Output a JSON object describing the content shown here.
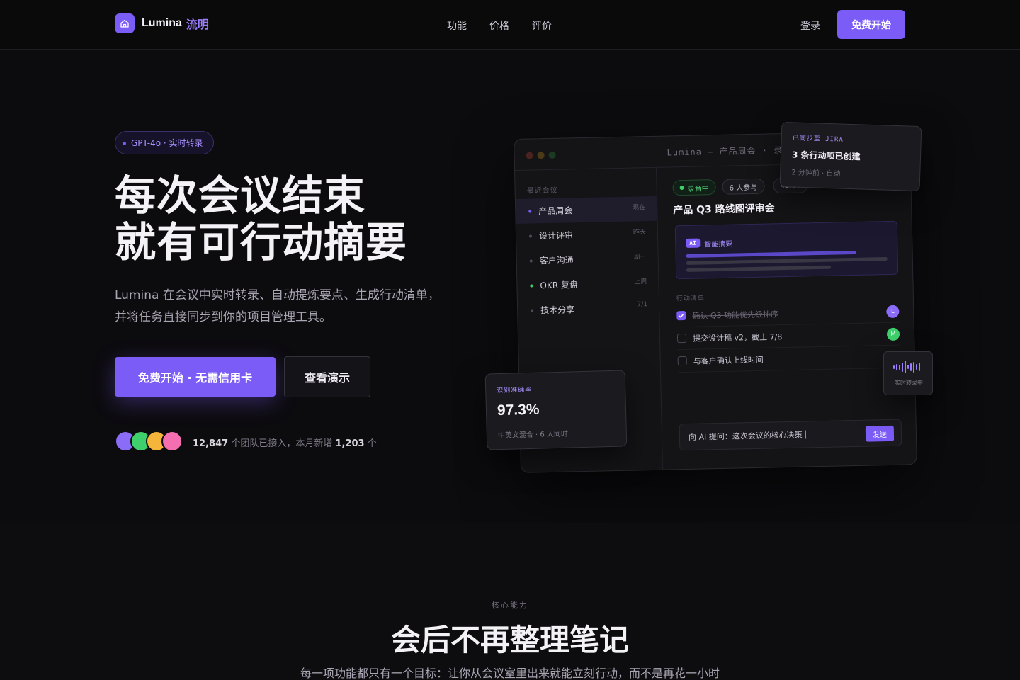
{
  "nav": {
    "brand": "Lumina",
    "brand_cn": "流明",
    "links": [
      "功能",
      "价格",
      "评价"
    ],
    "login": "登录",
    "cta": "免费开始"
  },
  "hero": {
    "badge": "GPT-4o · 实时转录",
    "title_line1": "每次会议结束",
    "title_line2": "就有可行动摘要",
    "subtitle_line1": "Lumina 在会议中实时转录、自动提炼要点、生成行动清单，",
    "subtitle_line2": "并将任务直接同步到你的项目管理工具。",
    "primary_cta": "免费开始 · 无需信用卡",
    "secondary_cta": "查看演示",
    "proof_count": "12,847",
    "proof_text1": "个团队已接入，本月新增",
    "proof_new": "1,203",
    "proof_text2": "个",
    "avatar_colors": [
      "#8b6cf7",
      "#3fcf6c",
      "#f5b53b",
      "#f36fb0"
    ]
  },
  "mock": {
    "window_title": "Lumina — 产品周会 · 录音",
    "sidebar_label": "最近会议",
    "meetings": [
      {
        "name": "产品周会",
        "time": "现在",
        "dot": "#7c5cf6"
      },
      {
        "name": "设计评审",
        "time": "昨天",
        "dot": "#4d4a55"
      },
      {
        "name": "客户沟通",
        "time": "周一",
        "dot": "#4d4a55"
      },
      {
        "name": "OKR 复盘",
        "time": "上周",
        "dot": "#3fcf6c"
      },
      {
        "name": "技术分享",
        "time": "7/1",
        "dot": "#4d4a55"
      }
    ],
    "chip_recording": "录音中",
    "chip_people": "6 人参与",
    "chip_more": "42:18",
    "meeting_title": "产品 Q3 路线图评审会",
    "ai_tag": "AI",
    "ai_label": "智能摘要",
    "tasks_label": "行动清单",
    "tasks": [
      {
        "text": "确认 Q3 功能优先级排序",
        "done": true,
        "owner": "L",
        "color": "#8b6cf7"
      },
      {
        "text": "提交设计稿 v2，截止 7/8",
        "done": false,
        "owner": "M",
        "color": "#3fcf6c"
      },
      {
        "text": "与客户确认上线时间",
        "done": false,
        "owner": "",
        "color": "#f5b53b"
      }
    ],
    "ask_placeholder": "向 AI 提问：这次会议的核心决策",
    "send": "发送"
  },
  "cards": {
    "jira_label": "已同步至 JIRA",
    "jira_main": "3 条行动项已创建",
    "jira_sub": "2 分钟前 · 自动",
    "accuracy_label": "识别准确率",
    "accuracy_value": "97.3%",
    "accuracy_sub": "中英文混合 · 6 人同时",
    "live_label": "实时转录中"
  },
  "features": {
    "eyebrow": "核心能力",
    "title": "会后不再整理笔记",
    "subtitle": "每一项功能都只有一个目标：让你从会议室里出来就能立刻行动，而不是再花一小时"
  }
}
